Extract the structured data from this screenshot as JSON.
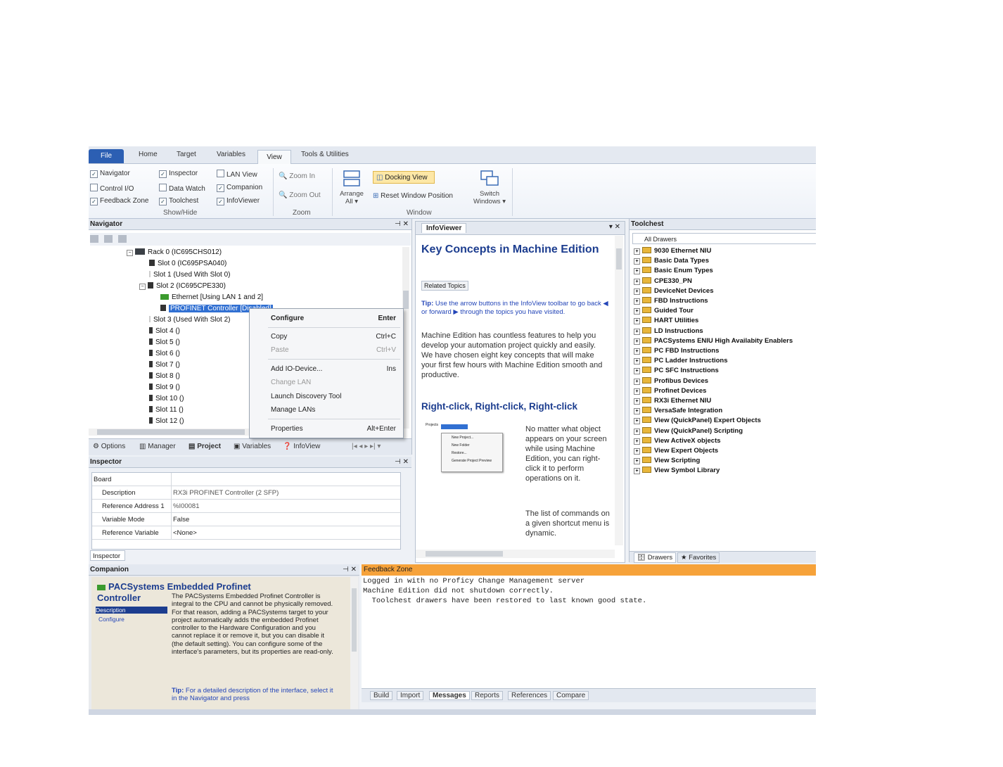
{
  "ribbon": {
    "tabs": [
      "File",
      "Home",
      "Target",
      "Variables",
      "View",
      "Tools & Utilities"
    ],
    "showhide": {
      "items": [
        {
          "label": "Navigator",
          "checked": true
        },
        {
          "label": "Control I/O",
          "checked": false
        },
        {
          "label": "Feedback Zone",
          "checked": true
        },
        {
          "label": "Inspector",
          "checked": true
        },
        {
          "label": "Data Watch",
          "checked": false
        },
        {
          "label": "Toolchest",
          "checked": true
        },
        {
          "label": "LAN View",
          "checked": false
        },
        {
          "label": "Companion",
          "checked": true
        },
        {
          "label": "InfoViewer",
          "checked": true
        }
      ],
      "group_label": "Show/Hide"
    },
    "zoom": {
      "zoom_in": "Zoom In",
      "zoom_out": "Zoom Out",
      "group_label": "Zoom"
    },
    "window": {
      "arrange": "Arrange",
      "arrange2": "All ▾",
      "docking_view": "Docking View",
      "reset_position": "Reset Window Position",
      "switch": "Switch",
      "switch2": "Windows ▾",
      "group_label": "Window"
    }
  },
  "navigator": {
    "title": "Navigator",
    "tree": [
      {
        "label": "Rack 0 (IC695CHS012)"
      },
      {
        "label": "Slot 0 (IC695PSA040)"
      },
      {
        "label": "Slot 1 (Used With Slot 0)"
      },
      {
        "label": "Slot 2 (IC695CPE330)"
      },
      {
        "label": "Ethernet [Using LAN 1 and 2]"
      },
      {
        "label": "PROFINET Controller [Disabled]"
      },
      {
        "label": "Slot 3 (Used With Slot 2)"
      },
      {
        "label": "Slot 4 ()"
      },
      {
        "label": "Slot 5 ()"
      },
      {
        "label": "Slot 6 ()"
      },
      {
        "label": "Slot 7 ()"
      },
      {
        "label": "Slot 8 ()"
      },
      {
        "label": "Slot 9 ()"
      },
      {
        "label": "Slot 10 ()"
      },
      {
        "label": "Slot 11 ()"
      },
      {
        "label": "Slot 12 ()"
      }
    ],
    "bottom_tabs": [
      "Options",
      "Manager",
      "Project",
      "Variables",
      "InfoView"
    ]
  },
  "context_menu": {
    "items": [
      {
        "label": "Configure",
        "shortcut": "Enter"
      },
      {
        "label": "Copy",
        "shortcut": "Ctrl+C"
      },
      {
        "label": "Paste",
        "shortcut": "Ctrl+V"
      },
      {
        "label": "Add IO-Device...",
        "shortcut": "Ins"
      },
      {
        "label": "Change LAN",
        "shortcut": ""
      },
      {
        "label": "Launch Discovery Tool",
        "shortcut": ""
      },
      {
        "label": "Manage LANs",
        "shortcut": ""
      },
      {
        "label": "Properties",
        "shortcut": "Alt+Enter"
      }
    ]
  },
  "inspector": {
    "title": "Inspector",
    "section": "Board",
    "rows": [
      {
        "name": "Description",
        "value": "RX3i PROFINET Controller (2 SFP)"
      },
      {
        "name": "Reference Address 1",
        "value": "%I00081"
      },
      {
        "name": "Variable Mode",
        "value": "False"
      },
      {
        "name": "Reference Variable",
        "value": "<None>"
      }
    ],
    "tab": "Inspector"
  },
  "infoviewer": {
    "tab": "InfoViewer",
    "heading": "Key Concepts in Machine Edition",
    "related_topics": "Related Topics",
    "tip_label": "Tip:",
    "tip_text": "Use the arrow buttons in the InfoView toolbar to go back",
    "tip_text2": "or forward",
    "tip_text3": "through the topics you have visited.",
    "paragraph": "Machine Edition has countless features to help you develop your automation project quickly and easily. We have chosen eight key concepts that will make your first few hours with Machine Edition smooth and productive.",
    "subheading": "Right-click, Right-click, Right-click",
    "side_text1": "No matter what object appears on your screen while using Machine Edition, you can right-click it to perform operations on it.",
    "side_text2": "The list of commands on a given shortcut menu is dynamic.",
    "thumb_items": [
      "New Project...",
      "New Folder",
      "Restore...",
      "Generate Project Preview"
    ],
    "thumb_root": "Projects"
  },
  "toolchest": {
    "title": "Toolchest",
    "dropdown": "All Drawers",
    "items": [
      "9030 Ethernet NIU",
      "Basic Data Types",
      "Basic Enum Types",
      "CPE330_PN",
      "DeviceNet Devices",
      "FBD Instructions",
      "Guided Tour",
      "HART Utilities",
      "LD Instructions",
      "PACSystems ENIU High Availabity Enablers",
      "PC FBD Instructions",
      "PC Ladder Instructions",
      "PC SFC Instructions",
      "Profibus Devices",
      "Profinet Devices",
      "RX3i Ethernet NIU",
      "VersaSafe Integration",
      "View (QuickPanel) Expert Objects",
      "View (QuickPanel) Scripting",
      "View ActiveX objects",
      "View Expert Objects",
      "View Scripting",
      "View Symbol Library"
    ],
    "tabs": [
      "Drawers",
      "Favorites"
    ]
  },
  "companion": {
    "title": "Companion",
    "heading": "PACSystems Embedded Profinet Controller",
    "links": [
      "Description",
      "Configure"
    ],
    "body": "The PACSystems Embedded Profinet Controller is integral to the CPU and cannot be physically removed. For that reason, adding a PACSystems target to your project automatically adds the embedded Profinet controller to the Hardware Configuration and you cannot replace it or remove it, but you can disable it (the default setting). You can configure some of the interface's parameters, but its properties are read-only.",
    "tip_label": "Tip:",
    "tip": "For a detailed description of the interface, select it in the Navigator and press"
  },
  "feedback": {
    "title": "Feedback Zone",
    "lines": [
      "Logged in with no Proficy Change Management server",
      "Machine Edition did not shutdown correctly.",
      "  Toolchest drawers have been restored to last known good state."
    ],
    "tabs": [
      "Build",
      "Import",
      "Messages",
      "Reports",
      "References",
      "Compare"
    ]
  },
  "colors": {
    "accent": "#2c5fb3",
    "feedback_bar": "#f6a23a",
    "selection": "#3170d2",
    "heading": "#1c3d8f"
  }
}
